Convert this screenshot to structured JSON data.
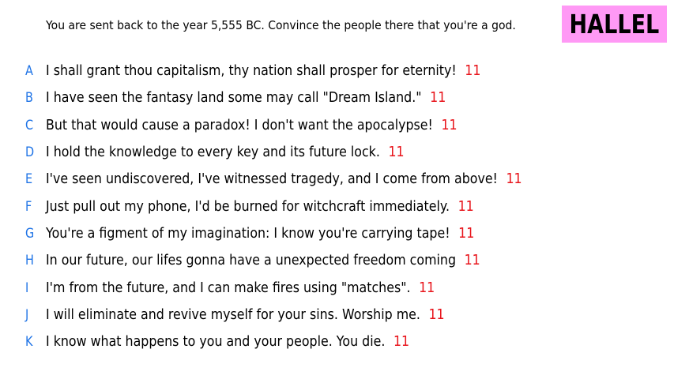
{
  "prompt": "You are sent back to the year 5,555 BC. Convince the people there that you're a god.",
  "player": {
    "name": "HALLEL",
    "color": "#ff99f5"
  },
  "colors": {
    "letter": "#1e73e6",
    "score": "#e8141b"
  },
  "answers": [
    {
      "letter": "A",
      "text": "I shall grant thou capitalism, thy nation shall prosper for eternity!",
      "score": "11"
    },
    {
      "letter": "B",
      "text": "I have seen the fantasy land some may call \"Dream Island.\"",
      "score": "11"
    },
    {
      "letter": "C",
      "text": "But that would cause a paradox! I don't want the apocalypse!",
      "score": "11"
    },
    {
      "letter": "D",
      "text": "I hold the knowledge to every key and its future lock.",
      "score": "11"
    },
    {
      "letter": "E",
      "text": "I've seen undiscovered, I've witnessed tragedy, and I come from above!",
      "score": "11"
    },
    {
      "letter": "F",
      "text": "Just pull out my phone, I'd be burned for witchcraft immediately.",
      "score": "11"
    },
    {
      "letter": "G",
      "text": "You're a figment of my imagination: I know you're carrying tape!",
      "score": "11"
    },
    {
      "letter": "H",
      "text": "In our future, our lifes gonna have a unexpected freedom coming",
      "score": "11"
    },
    {
      "letter": "I",
      "text": "I'm from the future, and I can make fires using \"matches\".",
      "score": "11"
    },
    {
      "letter": "J",
      "text": "I will eliminate and revive myself for your sins. Worship me.",
      "score": "11"
    },
    {
      "letter": "K",
      "text": "I know what happens to you and your people. You die.",
      "score": "11"
    }
  ]
}
